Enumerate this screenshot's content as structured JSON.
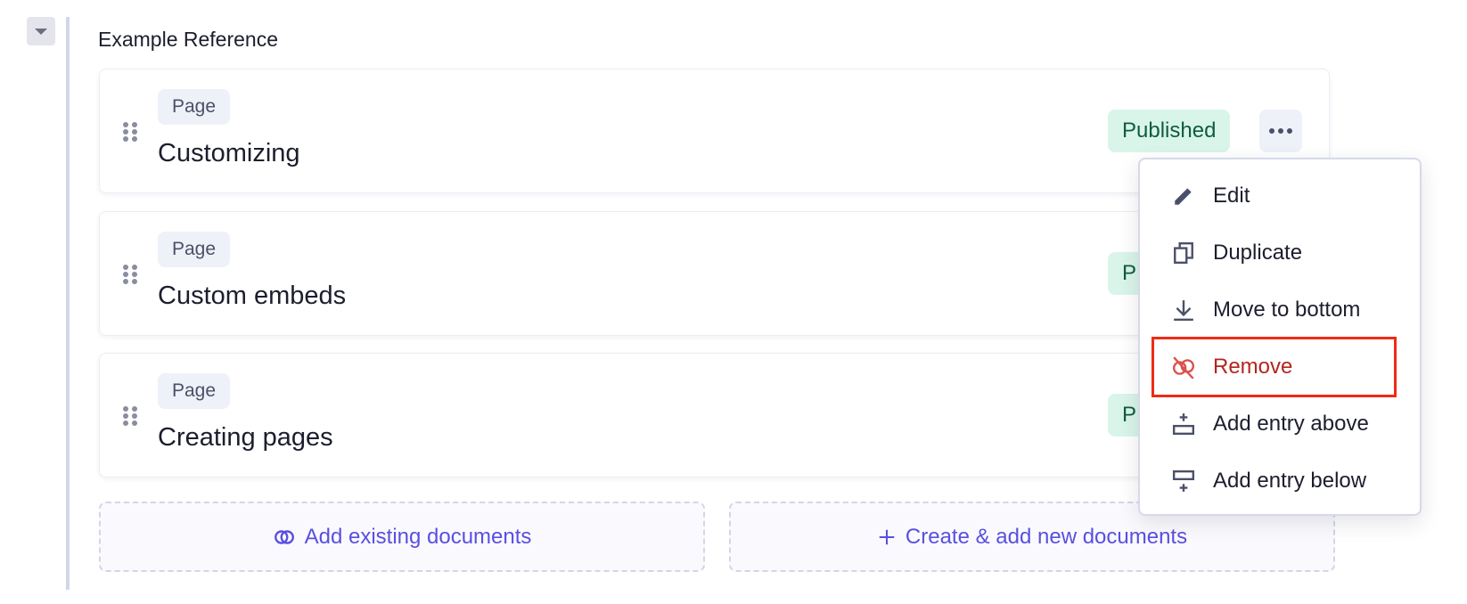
{
  "section": {
    "title": "Example Reference"
  },
  "items": [
    {
      "type": "Page",
      "title": "Customizing",
      "status": "Published"
    },
    {
      "type": "Page",
      "title": "Custom embeds",
      "status": "P"
    },
    {
      "type": "Page",
      "title": "Creating pages",
      "status": "P"
    }
  ],
  "menu": {
    "items": [
      {
        "label": "Edit",
        "icon": "pencil-icon"
      },
      {
        "label": "Duplicate",
        "icon": "copy-icon"
      },
      {
        "label": "Move to bottom",
        "icon": "arrow-down-to-line-icon"
      },
      {
        "label": "Remove",
        "icon": "unlink-icon",
        "highlighted": true
      },
      {
        "label": "Add entry above",
        "icon": "add-above-icon"
      },
      {
        "label": "Add entry below",
        "icon": "add-below-icon"
      }
    ]
  },
  "actions": {
    "add_existing": "Add existing documents",
    "create_new": "Create & add new documents"
  },
  "colors": {
    "accent": "#5a4fe0",
    "published_bg": "#d9f5ea",
    "published_text": "#105c3e",
    "danger": "#b3261e",
    "highlight": "#f02b14"
  }
}
